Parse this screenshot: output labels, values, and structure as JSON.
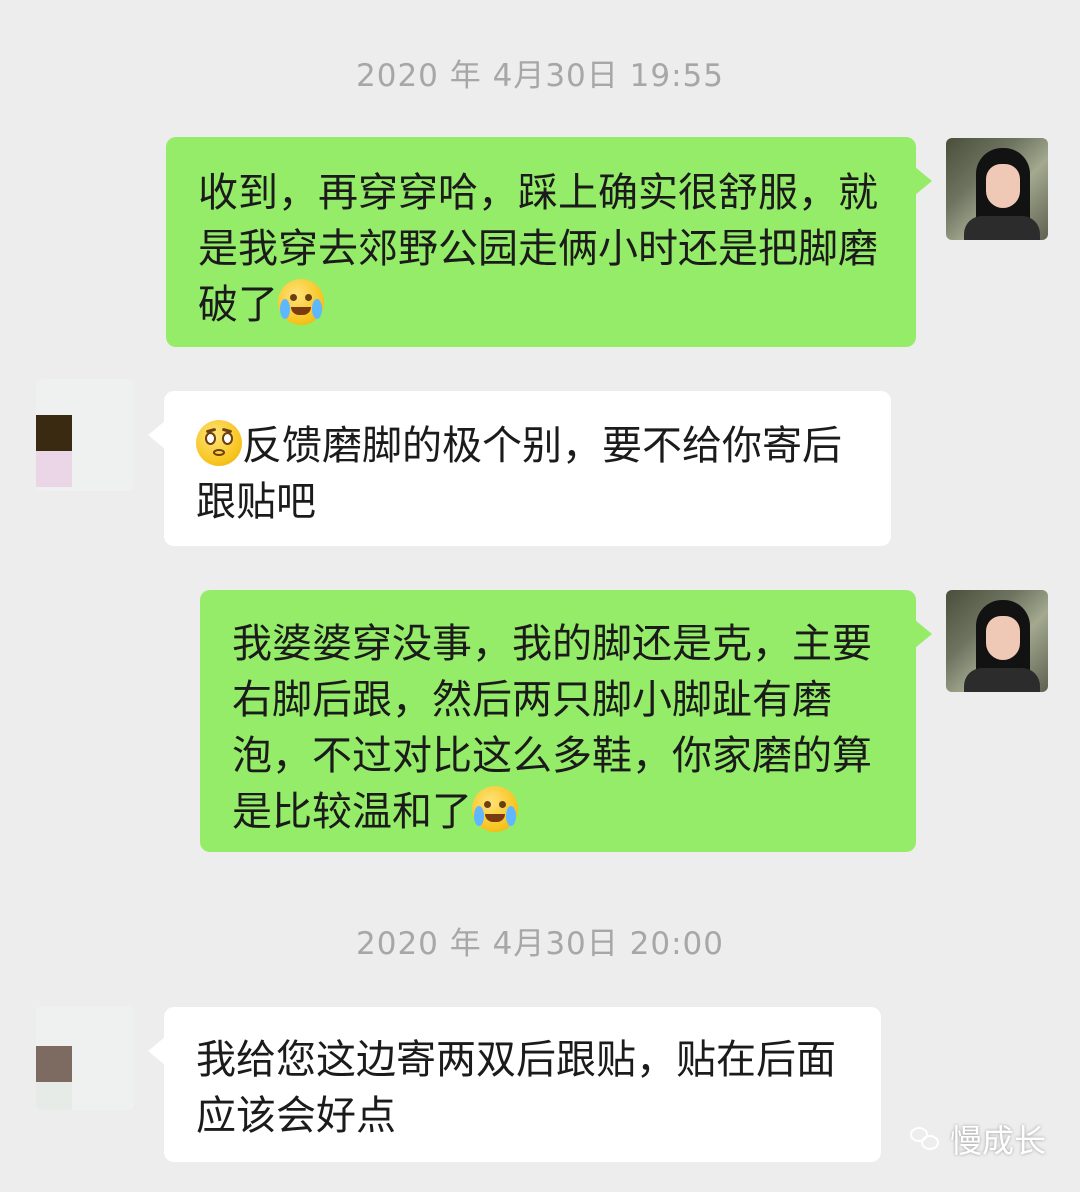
{
  "timestamps": {
    "first": "2020 年 4月30日 19:55",
    "second": "2020 年 4月30日 20:00"
  },
  "messages": [
    {
      "sender": "self",
      "text": "收到，再穿穿哈，踩上确实很舒服，就是我穿去郊野公园走俩小时还是把脚磨破了",
      "emoji": "loudly-crying-face"
    },
    {
      "sender": "other",
      "emoji": "pleading-face",
      "text": "反馈磨脚的极个别，要不给你寄后跟贴吧"
    },
    {
      "sender": "self",
      "text": "我婆婆穿没事，我的脚还是克，主要右脚后跟，然后两只脚小脚趾有磨泡，不过对比这么多鞋，你家磨的算是比较温和了",
      "emoji": "loudly-crying-face"
    },
    {
      "sender": "other",
      "text": "我给您这边寄两双后跟贴，贴在后面应该会好点"
    }
  ],
  "watermark": {
    "icon": "wechat-icon",
    "text": "慢成长"
  },
  "colors": {
    "background": "#ededed",
    "self_bubble": "#95ec69",
    "other_bubble": "#ffffff",
    "timestamp": "#a7a7a7"
  }
}
